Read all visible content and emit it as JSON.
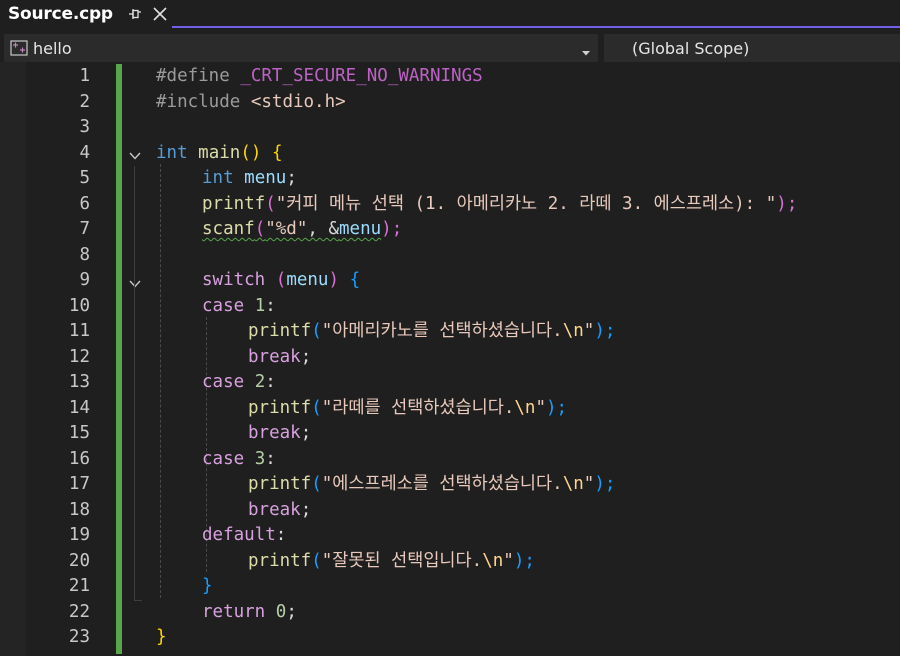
{
  "tab": {
    "title": "Source.cpp"
  },
  "navbar": {
    "project": "hello",
    "scope": "(Global Scope)"
  },
  "line_numbers": [
    "1",
    "2",
    "3",
    "4",
    "5",
    "6",
    "7",
    "8",
    "9",
    "10",
    "11",
    "12",
    "13",
    "14",
    "15",
    "16",
    "17",
    "18",
    "19",
    "20",
    "21",
    "22",
    "23"
  ],
  "code": {
    "l1": {
      "pp": "#define",
      "macro": "_CRT_SECURE_NO_WARNINGS"
    },
    "l2": {
      "pp": "#include",
      "hdr": "<stdio.h>"
    },
    "l4": {
      "kw": "int",
      "fn": "main",
      "parens": "()",
      "brace": "{"
    },
    "l5": {
      "kw": "int",
      "var": "menu",
      "semi": ";"
    },
    "l6": {
      "fn": "printf",
      "open": "(",
      "str": "\"커피 메뉴 선택 (1. 아메리카노 2. 라떼 3. 에스프레소): \"",
      "close": ");"
    },
    "l7": {
      "fn": "scanf",
      "open": "(",
      "str": "\"%d\"",
      "comma": ", ",
      "amp": "&",
      "var": "menu",
      "close": ");"
    },
    "l9": {
      "ctl": "switch",
      "open": "(",
      "var": "menu",
      "close": ")",
      "brace": "{"
    },
    "l10": {
      "ctl": "case",
      "num": "1",
      "colon": ":"
    },
    "l11": {
      "fn": "printf",
      "open": "(",
      "str": "\"아메리카노를 선택하셨습니다.",
      "esc": "\\n",
      "strend": "\"",
      "close": ");"
    },
    "l12": {
      "ctl": "break",
      "semi": ";"
    },
    "l13": {
      "ctl": "case",
      "num": "2",
      "colon": ":"
    },
    "l14": {
      "fn": "printf",
      "open": "(",
      "str": "\"라떼를 선택하셨습니다.",
      "esc": "\\n",
      "strend": "\"",
      "close": ");"
    },
    "l15": {
      "ctl": "break",
      "semi": ";"
    },
    "l16": {
      "ctl": "case",
      "num": "3",
      "colon": ":"
    },
    "l17": {
      "fn": "printf",
      "open": "(",
      "str": "\"에스프레소를 선택하셨습니다.",
      "esc": "\\n",
      "strend": "\"",
      "close": ");"
    },
    "l18": {
      "ctl": "break",
      "semi": ";"
    },
    "l19": {
      "ctl": "default",
      "colon": ":"
    },
    "l20": {
      "fn": "printf",
      "open": "(",
      "str": "\"잘못된 선택입니다.",
      "esc": "\\n",
      "strend": "\"",
      "close": ");"
    },
    "l21": {
      "brace": "}"
    },
    "l22": {
      "ctl": "return",
      "num": "0",
      "semi": ";"
    },
    "l23": {
      "brace": "}"
    }
  },
  "colors": {
    "accent": "#7160e8",
    "change_bar": "#57a64a",
    "background": "#1f1f1f"
  },
  "icons": {
    "pin": "pin-icon",
    "close": "close-icon",
    "project": "cpp-project-icon",
    "dropdown": "chevron-down-icon",
    "fold": "chevron-down-icon"
  }
}
